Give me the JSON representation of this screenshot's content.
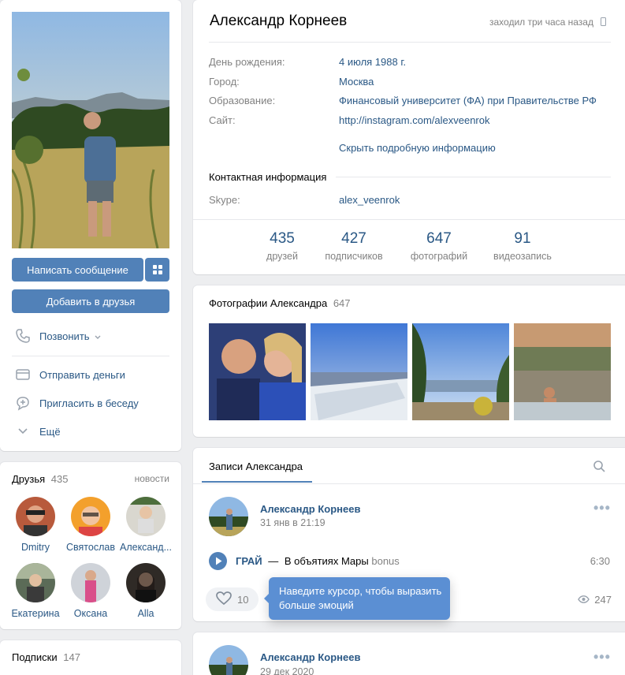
{
  "profile": {
    "name": "Александр Корнеев",
    "last_seen": "заходил три часа назад",
    "info": [
      {
        "label": "День рождения:",
        "value": "4 июля 1988 г."
      },
      {
        "label": "Город:",
        "value": "Москва"
      },
      {
        "label": "Образование:",
        "value": "Финансовый университет (ФА) при Правительстве РФ"
      },
      {
        "label": "Сайт:",
        "value": "http://instagram.com/alexveenrok"
      }
    ],
    "hide_details": "Скрыть подробную информацию",
    "contact_header": "Контактная информация",
    "contact": {
      "label": "Skype:",
      "value": "alex_veenrok"
    },
    "counters": [
      {
        "num": "435",
        "cap": "друзей"
      },
      {
        "num": "427",
        "cap": "подписчиков"
      },
      {
        "num": "647",
        "cap": "фотографий"
      },
      {
        "num": "91",
        "cap": "видеозапись"
      }
    ]
  },
  "actions": {
    "write": "Написать сообщение",
    "add_friend": "Добавить в друзья",
    "call": "Позвонить",
    "send_money": "Отправить деньги",
    "invite": "Пригласить в беседу",
    "more": "Ещё"
  },
  "friends": {
    "title": "Друзья",
    "count": "435",
    "news": "новости",
    "items": [
      "Dmitry",
      "Святослав",
      "Александ...",
      "Екатерина",
      "Оксана",
      "Alla"
    ]
  },
  "subscriptions": {
    "title": "Подписки",
    "count": "147"
  },
  "photos": {
    "title": "Фотографии Александра",
    "count": "647"
  },
  "wall": {
    "tab": "Записи Александра",
    "post": {
      "author": "Александр Корнеев",
      "date": "31 янв в 21:19",
      "artist": "ГРАЙ",
      "dash": "—",
      "track": "В объятиях Мары",
      "track_extra": "bonus",
      "duration": "6:30",
      "likes": "10",
      "views": "247"
    },
    "tooltip": "Наведите курсор, чтобы выразить больше эмоций",
    "post2": {
      "author": "Александр Корнеев",
      "date": "29 дек 2020"
    }
  },
  "colors": {
    "accent": "#5181b8",
    "link": "#2a5885",
    "muted": "#828282",
    "tooltip": "#5b8fd3"
  }
}
